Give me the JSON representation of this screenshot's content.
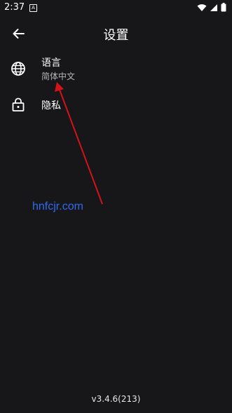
{
  "status_bar": {
    "time": "2:37",
    "notification_badge": "A"
  },
  "header": {
    "title": "设置"
  },
  "settings": {
    "language": {
      "label": "语言",
      "value": "简体中文",
      "icon": "globe-icon"
    },
    "privacy": {
      "label": "隐私",
      "icon": "lock-icon"
    }
  },
  "watermark": "hnfcjr.com",
  "footer": {
    "version": "v3.4.6(213)"
  },
  "colors": {
    "background": "#17171a",
    "annotation_arrow": "#d21418",
    "watermark": "#2f6bf0"
  }
}
